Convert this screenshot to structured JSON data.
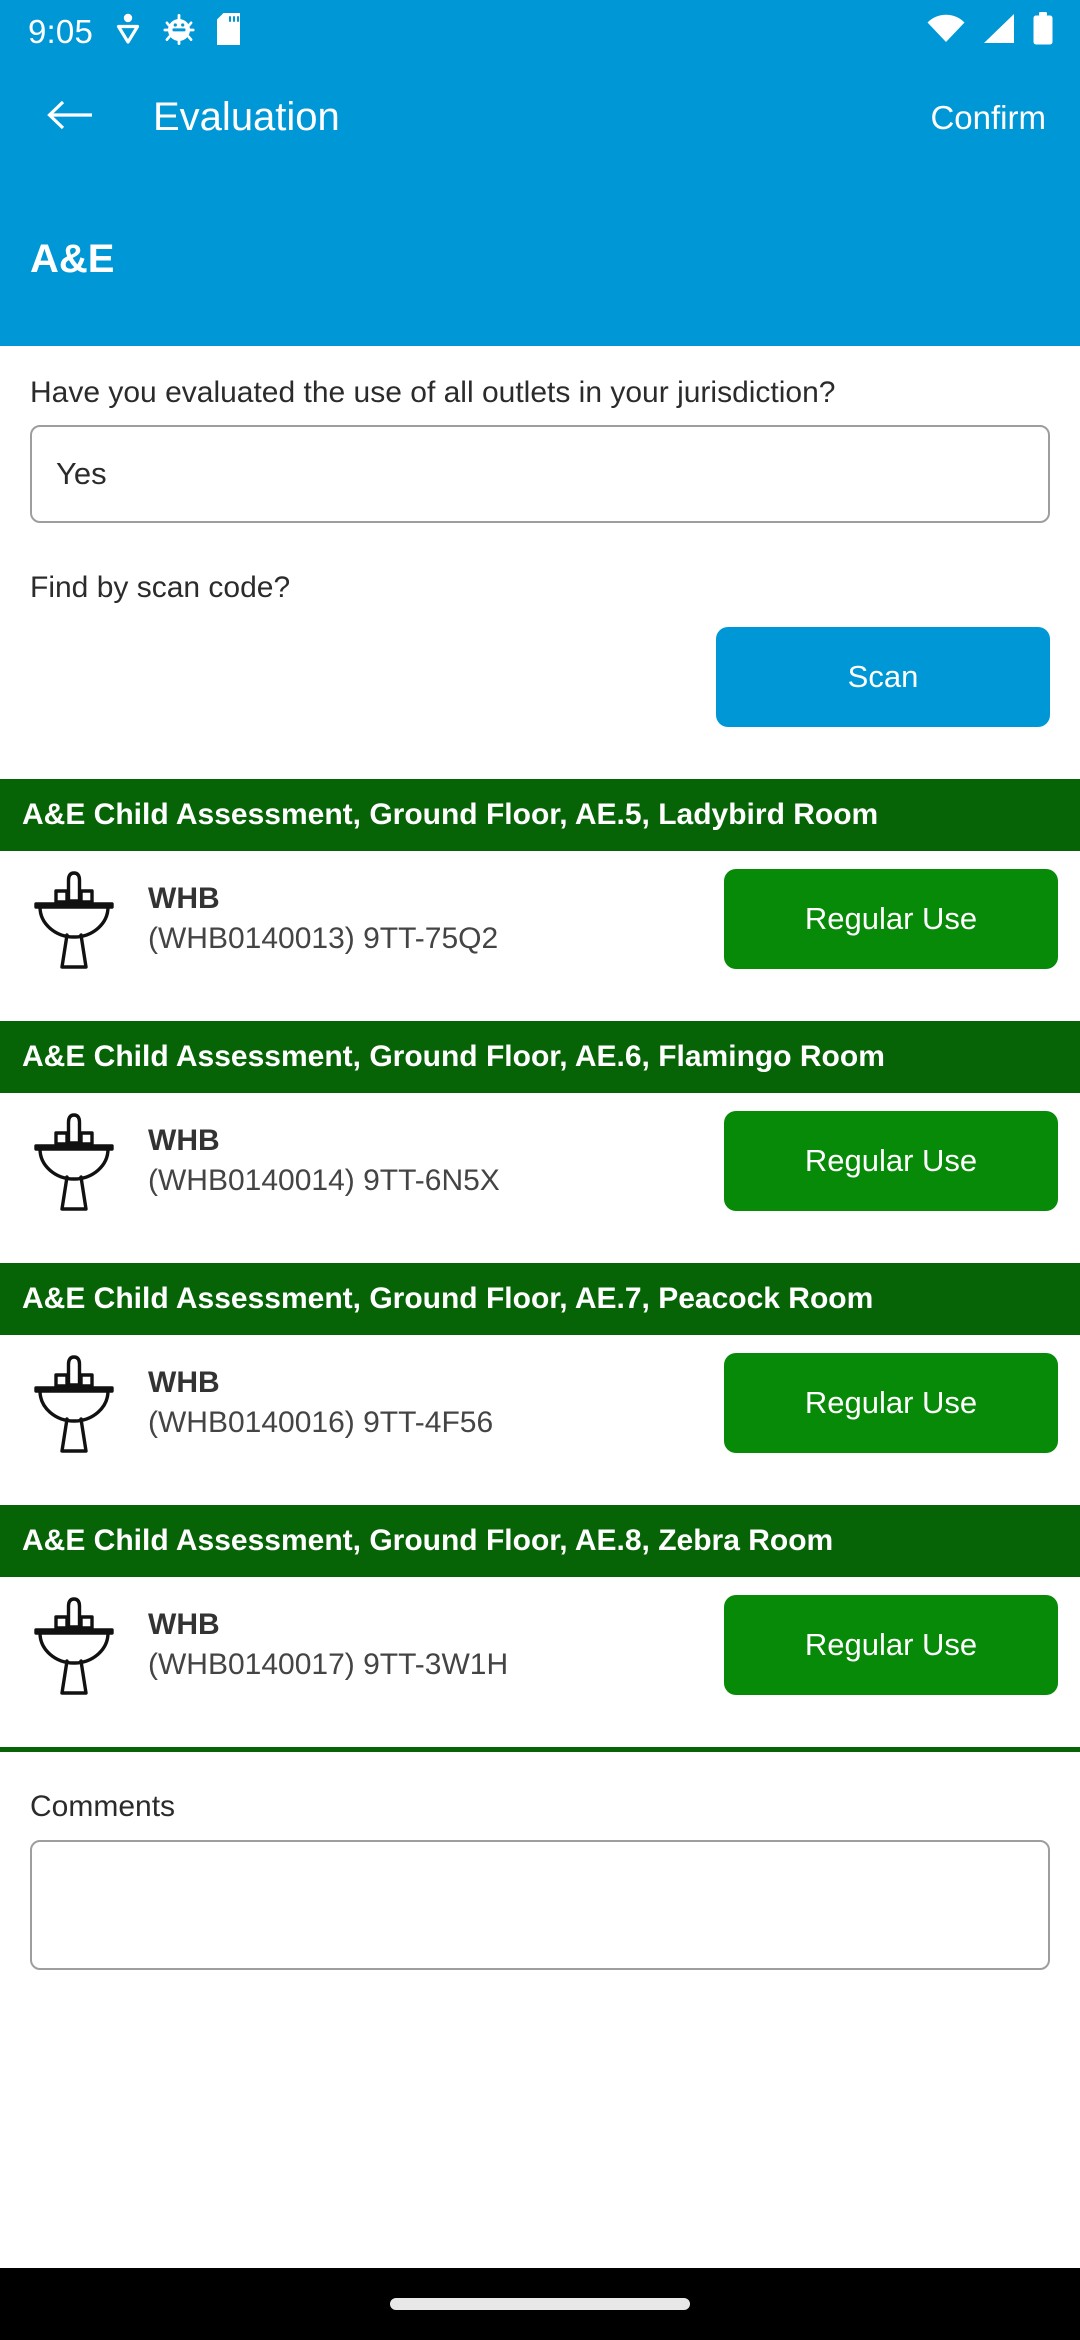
{
  "status_bar": {
    "time": "9:05",
    "left_icons": [
      "download-person-icon",
      "android-debug-icon",
      "sd-card-icon"
    ],
    "right_icons": [
      "wifi-icon",
      "cellular-signal-icon",
      "battery-icon"
    ]
  },
  "appbar": {
    "back_icon": "arrow-left-icon",
    "title": "Evaluation",
    "confirm_label": "Confirm"
  },
  "subheader": {
    "title": "A&E"
  },
  "evaluation_question": {
    "label": "Have you evaluated the use of all outlets in your jurisdiction?",
    "value": "Yes"
  },
  "scan": {
    "label": "Find by scan code?",
    "button_label": "Scan"
  },
  "groups": [
    {
      "header": "A&E Child Assessment, Ground Floor, AE.5, Ladybird Room",
      "assets": [
        {
          "icon": "wash-hand-basin-icon",
          "title": "WHB",
          "subtitle": "(WHB0140013) 9TT-75Q2",
          "status_label": "Regular Use"
        }
      ]
    },
    {
      "header": "A&E Child Assessment, Ground Floor, AE.6, Flamingo Room",
      "assets": [
        {
          "icon": "wash-hand-basin-icon",
          "title": "WHB",
          "subtitle": "(WHB0140014) 9TT-6N5X",
          "status_label": "Regular Use"
        }
      ]
    },
    {
      "header": "A&E Child Assessment, Ground Floor, AE.7, Peacock Room",
      "assets": [
        {
          "icon": "wash-hand-basin-icon",
          "title": "WHB",
          "subtitle": "(WHB0140016) 9TT-4F56",
          "status_label": "Regular Use"
        }
      ]
    },
    {
      "header": "A&E Child Assessment, Ground Floor, AE.8, Zebra Room",
      "assets": [
        {
          "icon": "wash-hand-basin-icon",
          "title": "WHB",
          "subtitle": "(WHB0140017) 9TT-3W1H",
          "status_label": "Regular Use"
        }
      ]
    }
  ],
  "comments": {
    "label": "Comments",
    "value": ""
  },
  "colors": {
    "primary_blue": "#0097D7",
    "group_header_green": "#066306",
    "status_button_green": "#078A07",
    "divider_green": "#066306",
    "field_border": "#9e9e9e",
    "nav_background": "#000000"
  }
}
